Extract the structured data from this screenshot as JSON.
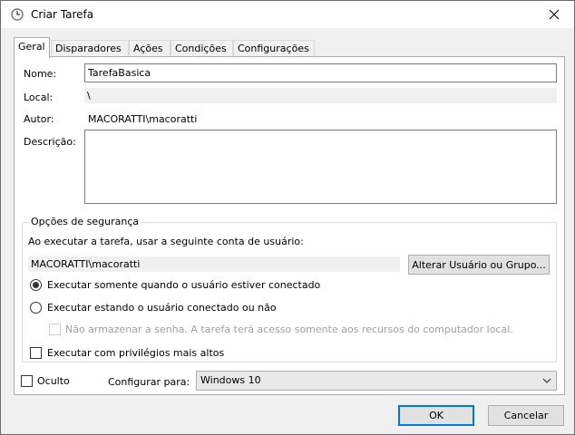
{
  "window": {
    "title": "Criar Tarefa"
  },
  "tabs": [
    {
      "label": "Geral",
      "active": true
    },
    {
      "label": "Disparadores"
    },
    {
      "label": "Ações"
    },
    {
      "label": "Condições"
    },
    {
      "label": "Configurações"
    }
  ],
  "general": {
    "name_label": "Nome:",
    "name_value": "TarefaBasica",
    "location_label": "Local:",
    "location_value": "\\",
    "author_label": "Autor:",
    "author_value": "MACORATTI\\macoratti",
    "description_label": "Descrição:",
    "description_value": ""
  },
  "security": {
    "group_title": "Opções de segurança",
    "run_as_text": "Ao executar a tarefa, usar a seguinte conta de usuário:",
    "account_value": "MACORATTI\\macoratti",
    "change_user_button": "Alterar Usuário ou Grupo...",
    "radio_logged_on": "Executar somente quando o usuário estiver conectado",
    "radio_logged_on_or_not": "Executar estando o usuário conectado ou não",
    "checkbox_no_password": "Não armazenar a senha. A tarefa terá acesso somente aos recursos do computador local.",
    "checkbox_highest_privileges": "Executar com privilégios mais altos",
    "selected_radio": "logged_on"
  },
  "bottom": {
    "hidden_label": "Oculto",
    "configure_for_label": "Configurar para:",
    "configure_for_value": "Windows 10"
  },
  "buttons": {
    "ok": "OK",
    "cancel": "Cancelar"
  },
  "colors": {
    "focus_border": "#0078d7",
    "dialog_bg": "#f0f0f0"
  }
}
